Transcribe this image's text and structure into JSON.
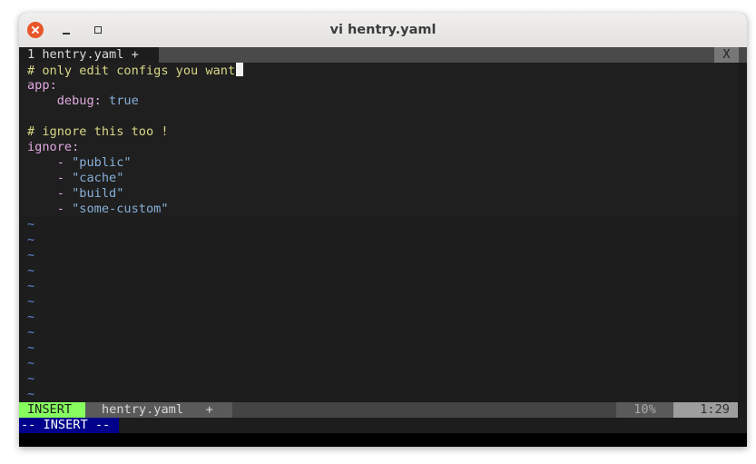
{
  "window": {
    "title": "vi hentry.yaml"
  },
  "tabline": {
    "tab_label": "1 hentry.yaml +",
    "close_label": "X"
  },
  "buffer": {
    "lines": [
      {
        "comment": "# only edit configs you want"
      },
      {
        "key": "app",
        "colon": ":"
      },
      {
        "indent": "    ",
        "key": "debug",
        "colon": ": ",
        "value": "true"
      },
      {
        "blank": ""
      },
      {
        "comment": "# ignore this too !"
      },
      {
        "key": "ignore",
        "colon": ":"
      },
      {
        "dash": "    - ",
        "string": "\"public\""
      },
      {
        "dash": "    - ",
        "string": "\"cache\""
      },
      {
        "dash": "    - ",
        "string": "\"build\""
      },
      {
        "dash": "    - ",
        "string": "\"some-custom\""
      }
    ],
    "tilde": "~"
  },
  "statusline": {
    "mode": "INSERT",
    "file": "hentry.yaml   +",
    "percent": "10%",
    "position": "1:29"
  },
  "cmdline": {
    "mode": "-- INSERT --"
  },
  "colors": {
    "comment": "#d7d787",
    "key": "#e0a8e0",
    "value": "#87afd7",
    "tilde": "#5f87d7",
    "insert_mode": "#87ff5f",
    "cmd_mode_bg": "#00008b"
  }
}
